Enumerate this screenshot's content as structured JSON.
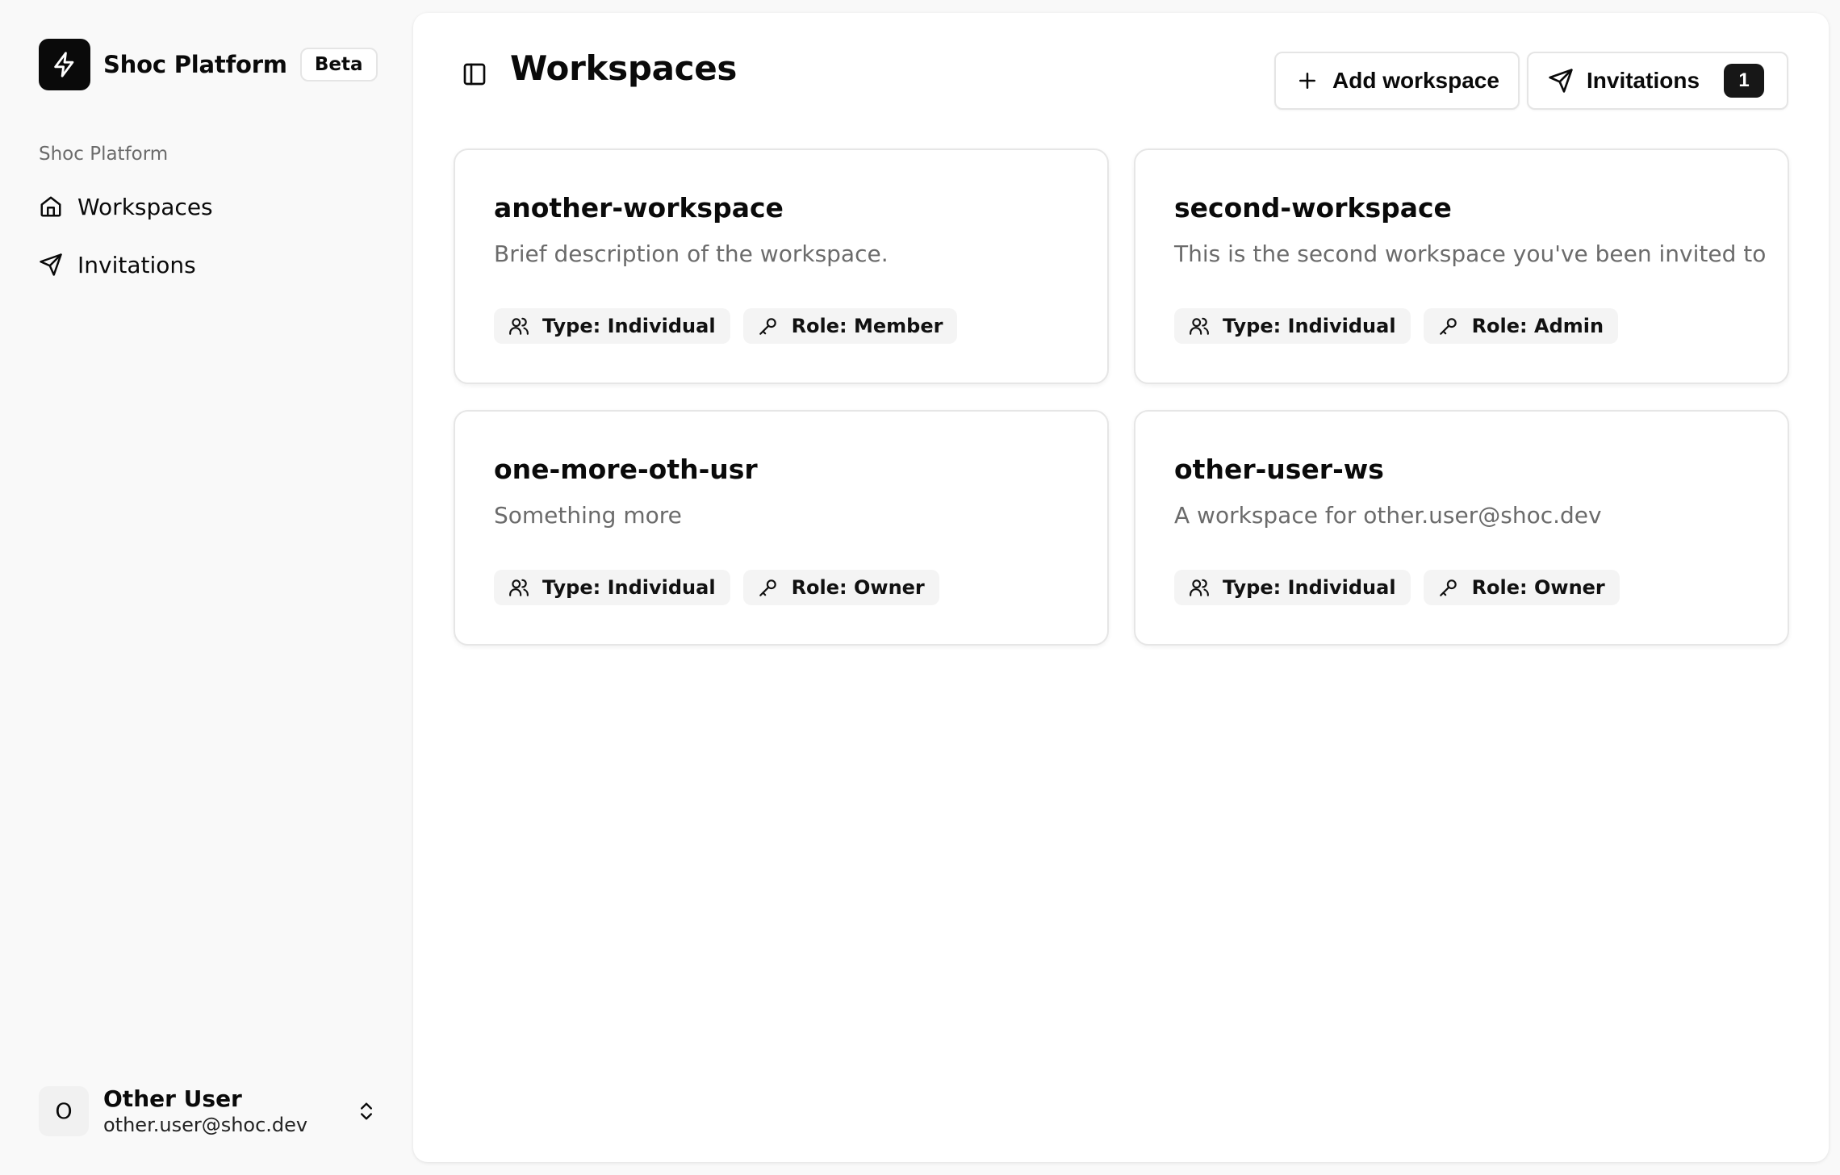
{
  "brand": {
    "name": "Shoc Platform",
    "badge": "Beta",
    "logo_icon": "lightning-bolt-icon",
    "logo_bg": "#0a0a0a"
  },
  "sidebar": {
    "group_label": "Shoc Platform",
    "items": [
      {
        "label": "Workspaces",
        "icon": "home-icon"
      },
      {
        "label": "Invitations",
        "icon": "send-icon"
      }
    ]
  },
  "user": {
    "initial": "O",
    "name": "Other User",
    "email": "other.user@shoc.dev"
  },
  "header": {
    "title": "Workspaces",
    "add_label": "Add workspace",
    "invitations_label": "Invitations",
    "invitations_count": "1"
  },
  "workspaces": [
    {
      "name": "another-workspace",
      "description": "Brief description of the workspace.",
      "type": "Type: Individual",
      "role": "Role: Member"
    },
    {
      "name": "second-workspace",
      "description": "This is the second workspace you've been invited to",
      "type": "Type: Individual",
      "role": "Role: Admin"
    },
    {
      "name": "one-more-oth-usr",
      "description": "Something more",
      "type": "Type: Individual",
      "role": "Role: Owner"
    },
    {
      "name": "other-user-ws",
      "description": "A workspace for other.user@shoc.dev",
      "type": "Type: Individual",
      "role": "Role: Owner"
    }
  ],
  "colors": {
    "accent": "#171717",
    "muted_text": "#6b6b6b",
    "chip_bg": "#f4f4f4",
    "page_bg": "#f9f9f9"
  }
}
